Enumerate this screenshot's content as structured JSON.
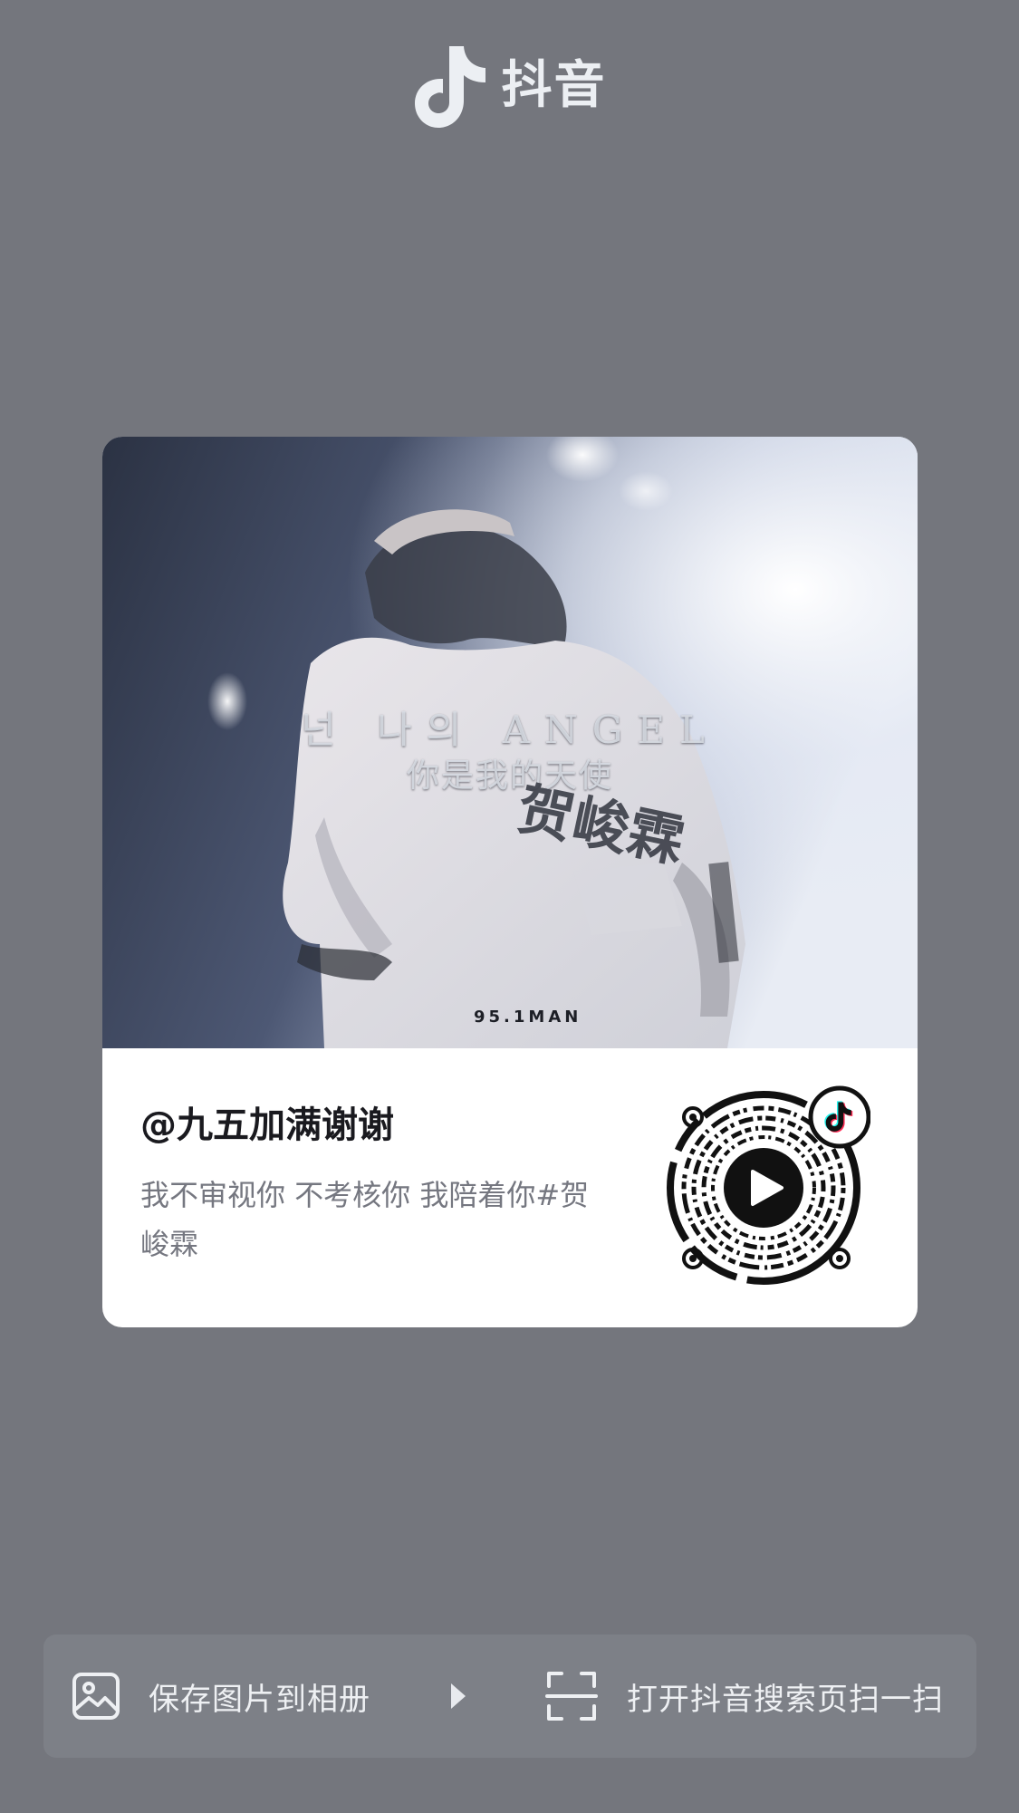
{
  "header": {
    "brand_name": "抖音",
    "logo_icon": "tiktok-note-icon"
  },
  "card": {
    "cover": {
      "overlay_line1": "넌 나의 ANGEL",
      "overlay_line2": "你是我的天使",
      "jersey_text": "贺峻霖",
      "watermark": "95.1MAN"
    },
    "author": "@九五加满谢谢",
    "description": "我不审视你 不考核你 我陪着你#贺峻霖",
    "qr_code": {
      "center_icon": "play-icon",
      "badge_icon": "tiktok-note-icon"
    }
  },
  "actions": {
    "save": {
      "label": "保存图片到相册",
      "icon": "image-icon"
    },
    "separator_icon": "triangle-right-icon",
    "scan": {
      "label": "打开抖音搜索页扫一扫",
      "icon": "scan-icon"
    }
  },
  "colors": {
    "background": "#74767d",
    "card": "#ffffff",
    "action_bar": "#7d8087",
    "primary_text": "#1a1a1f",
    "secondary_text": "#757780"
  }
}
